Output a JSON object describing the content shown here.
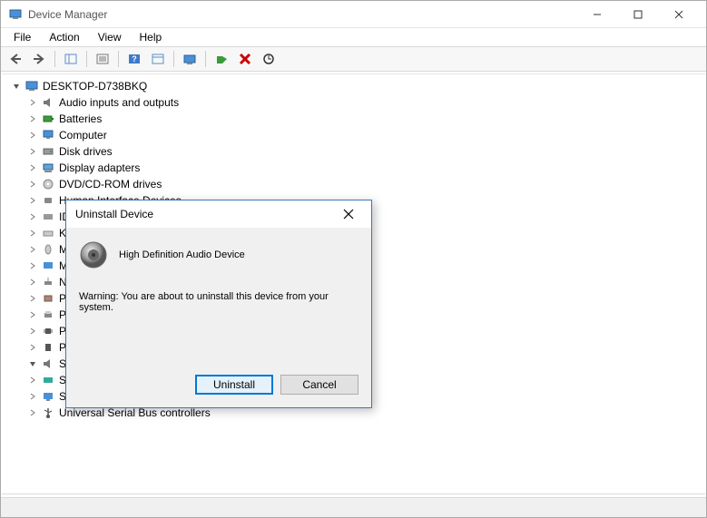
{
  "window": {
    "title": "Device Manager"
  },
  "menu": {
    "file": "File",
    "action": "Action",
    "view": "View",
    "help": "Help"
  },
  "tree": {
    "root": "DESKTOP-D738BKQ",
    "items": [
      {
        "label": "Audio inputs and outputs"
      },
      {
        "label": "Batteries"
      },
      {
        "label": "Computer"
      },
      {
        "label": "Disk drives"
      },
      {
        "label": "Display adapters"
      },
      {
        "label": "DVD/CD-ROM drives"
      },
      {
        "label": "Human Interface Devices"
      },
      {
        "label": "ID"
      },
      {
        "label": "K"
      },
      {
        "label": "M"
      },
      {
        "label": "M"
      },
      {
        "label": "N"
      },
      {
        "label": "P"
      },
      {
        "label": "P"
      },
      {
        "label": "P"
      },
      {
        "label": "P"
      },
      {
        "label": "S"
      },
      {
        "label": "St"
      },
      {
        "label": "System devices"
      },
      {
        "label": "Universal Serial Bus controllers"
      }
    ]
  },
  "dialog": {
    "title": "Uninstall Device",
    "device_name": "High Definition Audio Device",
    "warning": "Warning: You are about to uninstall this device from your system.",
    "uninstall": "Uninstall",
    "cancel": "Cancel"
  }
}
